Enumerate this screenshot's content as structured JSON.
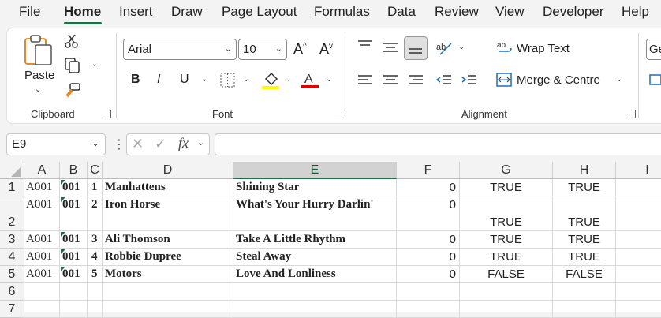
{
  "menu": {
    "items": [
      "File",
      "Home",
      "Insert",
      "Draw",
      "Page Layout",
      "Formulas",
      "Data",
      "Review",
      "View",
      "Developer",
      "Help"
    ],
    "active": "Home"
  },
  "ribbon": {
    "clipboard": {
      "paste_label": "Paste",
      "group_label": "Clipboard"
    },
    "font": {
      "font_name": "Arial",
      "font_size": "10",
      "group_label": "Font"
    },
    "alignment": {
      "wrap_text_label": "Wrap Text",
      "merge_label": "Merge & Centre",
      "group_label": "Alignment"
    },
    "number": {
      "format_partial": "Ge"
    }
  },
  "formula_bar": {
    "name_box": "E9",
    "formula": ""
  },
  "colors": {
    "accent": "#1e7145",
    "font_highlight": "#ffff00",
    "font_color": "#e00000"
  },
  "sheet": {
    "columns": [
      "A",
      "B",
      "C",
      "D",
      "E",
      "F",
      "G",
      "H",
      "I"
    ],
    "selected_column": "E",
    "row_numbers": [
      "1",
      "2",
      "3",
      "4",
      "5",
      "6",
      "7"
    ],
    "rows": [
      {
        "a": "A001",
        "b": "001",
        "c": "1",
        "d": "Manhattens",
        "e": "Shining Star",
        "f": "0",
        "g": "TRUE",
        "h": "TRUE"
      },
      {
        "a": "A001",
        "b": "001",
        "c": "2",
        "d": "Iron Horse",
        "e": "What's Your Hurry Darlin'",
        "f": "0",
        "g": "TRUE",
        "h": "TRUE"
      },
      {
        "a": "A001",
        "b": "001",
        "c": "3",
        "d": "Ali Thomson",
        "e": "Take A Little Rhythm",
        "f": "0",
        "g": "TRUE",
        "h": "TRUE"
      },
      {
        "a": "A001",
        "b": "001",
        "c": "4",
        "d": "Robbie Dupree",
        "e": "Steal Away",
        "f": "0",
        "g": "TRUE",
        "h": "TRUE"
      },
      {
        "a": "A001",
        "b": "001",
        "c": "5",
        "d": "Motors",
        "e": "Love And Lonliness",
        "f": "0",
        "g": "FALSE",
        "h": "FALSE"
      }
    ]
  }
}
